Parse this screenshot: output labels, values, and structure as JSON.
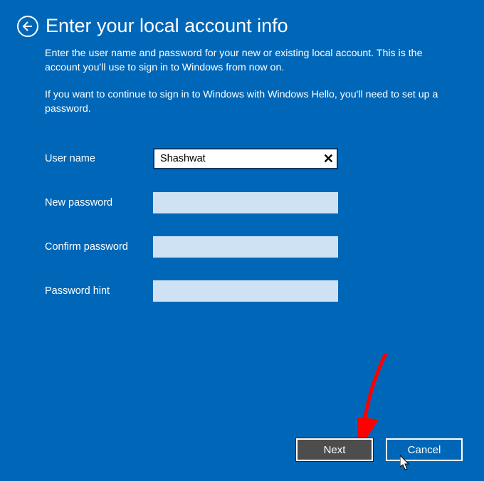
{
  "header": {
    "title": "Enter your local account info"
  },
  "description": {
    "p1": "Enter the user name and password for your new or existing local account. This is the account you'll use to sign in to Windows from now on.",
    "p2": "If you want to continue to sign in to Windows with Windows Hello, you'll need to set up a password."
  },
  "form": {
    "username": {
      "label": "User name",
      "value": "Shashwat"
    },
    "newpassword": {
      "label": "New password",
      "value": ""
    },
    "confirmpassword": {
      "label": "Confirm password",
      "value": ""
    },
    "passwordhint": {
      "label": "Password hint",
      "value": ""
    }
  },
  "buttons": {
    "next": "Next",
    "cancel": "Cancel"
  }
}
